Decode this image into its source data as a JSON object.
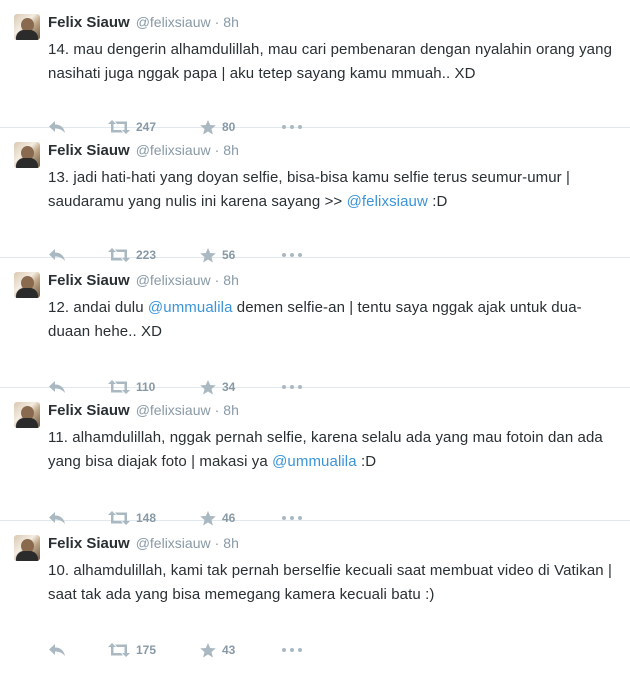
{
  "tweets": [
    {
      "name": "Felix Siauw",
      "handle": "@felixsiauw",
      "dot": "·",
      "time": "8h",
      "text_parts": [
        "14. mau dengerin alhamdulillah, mau cari pembenaran dengan nyalahin orang yang nasihati juga nggak papa | aku tetep sayang kamu mmuah.. XD"
      ],
      "retweets": "247",
      "favorites": "80"
    },
    {
      "name": "Felix Siauw",
      "handle": "@felixsiauw",
      "dot": "·",
      "time": "8h",
      "text_parts": [
        "13. jadi hati-hati yang doyan selfie, bisa-bisa kamu selfie terus seumur-umur | saudaramu yang nulis ini karena sayang >> ",
        "@felixsiauw",
        " :D"
      ],
      "retweets": "223",
      "favorites": "56"
    },
    {
      "name": "Felix Siauw",
      "handle": "@felixsiauw",
      "dot": "·",
      "time": "8h",
      "text_parts": [
        "12. andai dulu ",
        "@ummualila",
        " demen selfie-an | tentu saya nggak ajak untuk dua-duaan hehe.. XD"
      ],
      "retweets": "110",
      "favorites": "34"
    },
    {
      "name": "Felix Siauw",
      "handle": "@felixsiauw",
      "dot": "·",
      "time": "8h",
      "text_parts": [
        "11. alhamdulillah, nggak pernah selfie, karena selalu ada yang mau fotoin dan ada yang bisa diajak foto | makasi ya ",
        "@ummualila",
        " :D"
      ],
      "retweets": "148",
      "favorites": "46"
    },
    {
      "name": "Felix Siauw",
      "handle": "@felixsiauw",
      "dot": "·",
      "time": "8h",
      "text_parts": [
        "10. alhamdulillah, kami tak pernah berselfie kecuali saat membuat video di Vatikan | saat tak ada yang bisa memegang kamera kecuali batu :)"
      ],
      "retweets": "175",
      "favorites": "43"
    }
  ],
  "icons": {
    "reply": "reply-icon",
    "retweet": "retweet-icon",
    "favorite": "star-icon",
    "more": "more-icon"
  },
  "colors": {
    "link": "#3b94d9",
    "muted": "#8899a6",
    "icon": "#aab8c2",
    "text": "#292f33"
  }
}
